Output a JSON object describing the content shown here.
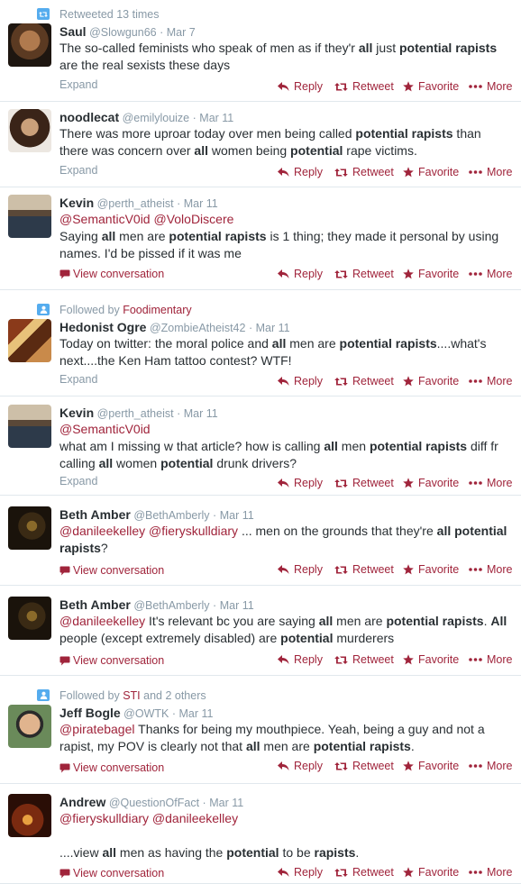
{
  "colors": {
    "link": "#a0243b",
    "muted": "#8899a6",
    "text": "#292f33",
    "divider": "#e1e8ed",
    "context_icon": "#55acee"
  },
  "actions": {
    "reply": "Reply",
    "retweet": "Retweet",
    "favorite": "Favorite",
    "more": "More"
  },
  "links": {
    "expand": "Expand",
    "view_conversation": "View conversation"
  },
  "tweets": [
    {
      "context": {
        "type": "retweet",
        "text": "Retweeted 13 times"
      },
      "name": "Saul",
      "handle": "@Slowgun66",
      "sep": "·",
      "date": "Mar 7",
      "body": [
        {
          "t": "The so-called feminists who speak of men as if they'r "
        },
        {
          "t": "all",
          "b": 1
        },
        {
          "t": " just "
        },
        {
          "t": "potential rapists",
          "b": 1
        },
        {
          "t": " are the real sexists these days"
        }
      ],
      "footer": "expand"
    },
    {
      "name": "noodlecat",
      "handle": "@emilylouize",
      "sep": "·",
      "date": "Mar 11",
      "body": [
        {
          "t": "There was more uproar today over men being called "
        },
        {
          "t": "potential rapists",
          "b": 1
        },
        {
          "t": " than there was concern over "
        },
        {
          "t": "all",
          "b": 1
        },
        {
          "t": " women being "
        },
        {
          "t": "potential",
          "b": 1
        },
        {
          "t": " rape victims."
        }
      ],
      "footer": "expand"
    },
    {
      "name": "Kevin",
      "handle": "@perth_atheist",
      "sep": "·",
      "date": "Mar 11",
      "body": [
        {
          "t": "@SemanticV0id",
          "m": 1
        },
        {
          "t": " "
        },
        {
          "t": "@VoloDiscere",
          "m": 1
        },
        {
          "br": 1
        },
        {
          "t": "Saying "
        },
        {
          "t": "all",
          "b": 1
        },
        {
          "t": " men are "
        },
        {
          "t": "potential rapists",
          "b": 1
        },
        {
          "t": " is 1 thing; they made it personal by using names. I'd be pissed if it was me"
        }
      ],
      "footer": "conversation"
    },
    {
      "context": {
        "type": "follow",
        "text": "Followed by ",
        "link": "Foodimentary"
      },
      "name": "Hedonist Ogre",
      "handle": "@ZombieAtheist42",
      "sep": "·",
      "date": "Mar 11",
      "body": [
        {
          "t": "Today on twitter: the moral police and "
        },
        {
          "t": "all",
          "b": 1
        },
        {
          "t": " men are "
        },
        {
          "t": "potential rapists",
          "b": 1
        },
        {
          "t": "....what's next....the Ken Ham tattoo contest? WTF!"
        }
      ],
      "footer": "expand"
    },
    {
      "name": "Kevin",
      "handle": "@perth_atheist",
      "sep": "·",
      "date": "Mar 11",
      "body": [
        {
          "t": "@SemanticV0id",
          "m": 1
        },
        {
          "br": 1
        },
        {
          "t": "what am I missing w that article? how is calling "
        },
        {
          "t": "all",
          "b": 1
        },
        {
          "t": " men "
        },
        {
          "t": "potential rapists",
          "b": 1
        },
        {
          "t": " diff fr calling "
        },
        {
          "t": "all",
          "b": 1
        },
        {
          "t": " women "
        },
        {
          "t": "potential",
          "b": 1
        },
        {
          "t": " drunk drivers?"
        }
      ],
      "footer": "expand"
    },
    {
      "name": "Beth Amber",
      "handle": "@BethAmberly",
      "sep": "·",
      "date": "Mar 11",
      "body": [
        {
          "t": "@danileekelley",
          "m": 1
        },
        {
          "t": " "
        },
        {
          "t": "@fieryskulldiary",
          "m": 1
        },
        {
          "t": " ... men on the grounds that they're "
        },
        {
          "t": "all potential rapists",
          "b": 1
        },
        {
          "t": "?"
        }
      ],
      "footer": "conversation"
    },
    {
      "name": "Beth Amber",
      "handle": "@BethAmberly",
      "sep": "·",
      "date": "Mar 11",
      "body": [
        {
          "t": "@danileekelley",
          "m": 1
        },
        {
          "t": " It's relevant bc you are saying "
        },
        {
          "t": "all",
          "b": 1
        },
        {
          "t": " men are "
        },
        {
          "t": "potential rapists",
          "b": 1
        },
        {
          "t": ". "
        },
        {
          "t": "All",
          "b": 1
        },
        {
          "t": " people (except extremely disabled) are "
        },
        {
          "t": "potential",
          "b": 1
        },
        {
          "t": " murderers"
        }
      ],
      "footer": "conversation"
    },
    {
      "context": {
        "type": "follow",
        "text": "Followed by ",
        "link": "STI",
        "rest": " and 2 others"
      },
      "name": "Jeff Bogle",
      "handle": "@OWTK",
      "sep": "·",
      "date": "Mar 11",
      "body": [
        {
          "t": "@piratebagel",
          "m": 1
        },
        {
          "t": " Thanks for being my mouthpiece. Yeah, being a guy and not a rapist, my POV is clearly not that "
        },
        {
          "t": "all",
          "b": 1
        },
        {
          "t": " men are "
        },
        {
          "t": "potential rapists",
          "b": 1
        },
        {
          "t": "."
        }
      ],
      "footer": "conversation"
    },
    {
      "name": "Andrew",
      "handle": "@QuestionOfFact",
      "sep": "·",
      "date": "Mar 11",
      "body": [
        {
          "t": "@fieryskulldiary",
          "m": 1
        },
        {
          "t": " "
        },
        {
          "t": "@danileekelley",
          "m": 1
        },
        {
          "br": 2
        },
        {
          "t": "....view "
        },
        {
          "t": "all",
          "b": 1
        },
        {
          "t": " men as having the "
        },
        {
          "t": "potential",
          "b": 1
        },
        {
          "t": " to be "
        },
        {
          "t": "rapists",
          "b": 1
        },
        {
          "t": "."
        }
      ],
      "footer": "conversation"
    }
  ]
}
